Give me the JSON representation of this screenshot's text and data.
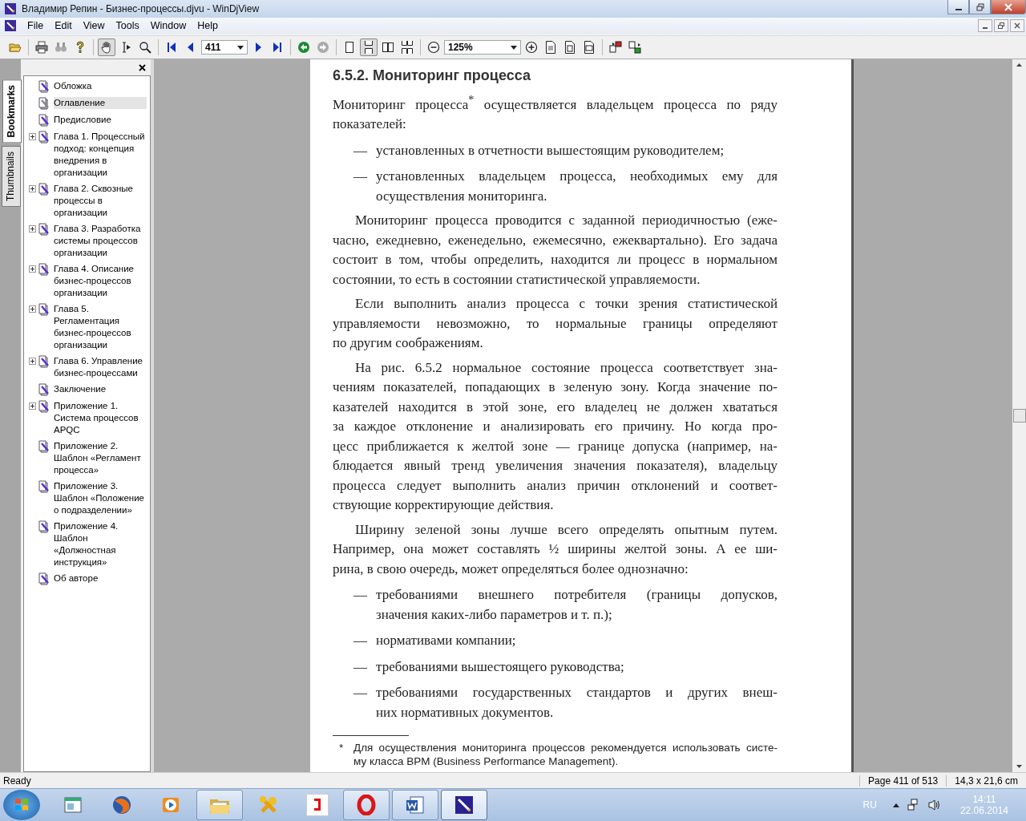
{
  "window": {
    "title": "Владимир Репин - Бизнес-процессы.djvu - WinDjView"
  },
  "menu": [
    "File",
    "Edit",
    "View",
    "Tools",
    "Window",
    "Help"
  ],
  "toolbar": {
    "page_field": "411",
    "zoom_field": "125%",
    "tool_buttons": [
      {
        "selected": true
      },
      {
        "selected": false
      },
      {
        "selected": false
      }
    ],
    "layout_buttons": [
      {
        "selected": false
      },
      {
        "selected": true
      },
      {
        "selected": false
      },
      {
        "selected": false
      }
    ]
  },
  "side_tabs": [
    {
      "label": "Bookmarks",
      "selected": true
    },
    {
      "label": "Thumbnails",
      "selected": false
    }
  ],
  "bookmarks": [
    {
      "label": "Обложка",
      "expandable": false,
      "selected": false
    },
    {
      "label": "Оглавление",
      "expandable": false,
      "selected": true
    },
    {
      "label": "Предисловие",
      "expandable": false,
      "selected": false
    },
    {
      "label": "Глава 1. Процессный подход: концепция внедрения в организации",
      "expandable": true,
      "selected": false
    },
    {
      "label": "Глава 2. Сквозные процессы в организации",
      "expandable": true,
      "selected": false
    },
    {
      "label": "Глава 3. Разработка системы процессов организации",
      "expandable": true,
      "selected": false
    },
    {
      "label": "Глава 4. Описание бизнес-процессов организации",
      "expandable": true,
      "selected": false
    },
    {
      "label": "Глава 5. Регламентация бизнес-процессов организации",
      "expandable": true,
      "selected": false
    },
    {
      "label": "Глава 6. Управление бизнес-процессами",
      "expandable": true,
      "selected": false
    },
    {
      "label": "Заключение",
      "expandable": false,
      "selected": false
    },
    {
      "label": "Приложение 1. Система процессов APQC",
      "expandable": true,
      "selected": false
    },
    {
      "label": "Приложение 2. Шаблон «Регламент процесса»",
      "expandable": false,
      "selected": false
    },
    {
      "label": "Приложение 3. Шаблон «Положение о подразделении»",
      "expandable": false,
      "selected": false
    },
    {
      "label": "Приложение 4. Шаблон «Должностная инструкция»",
      "expandable": false,
      "selected": false
    },
    {
      "label": "Об авторе",
      "expandable": false,
      "selected": false
    }
  ],
  "page": {
    "blocks": [
      {
        "kind": "heading",
        "lines": [
          "6.5.2. Мониторинг процесса"
        ]
      },
      {
        "kind": "paragraph",
        "indent": false,
        "lines": [
          "Мониторинг процесса$^{*}$ осуществляется владельцем процесса по ряду",
          "показателей:"
        ]
      },
      {
        "kind": "dash",
        "marker": "—",
        "lines": [
          "установленных в отчетности вышестоящим руководителем;"
        ]
      },
      {
        "kind": "dash",
        "marker": "—",
        "lines": [
          "установленных владельцем процесса, необходимых ему для",
          "осуществления мониторинга."
        ]
      },
      {
        "kind": "paragraph",
        "indent": true,
        "lines": [
          "Мониторинг процесса проводится с заданной периодичностью (еже-",
          "часно, ежедневно, еженедельно, ежемесячно, ежеквартально). Его задача",
          "состоит в том, чтобы определить, находится ли процесс в нормальном",
          "состоянии, то есть в состоянии статистической управляемости."
        ]
      },
      {
        "kind": "paragraph",
        "indent": true,
        "lines": [
          "Если выполнить анализ процесса с точки зрения статистической",
          "управляемости невозможно, то нормальные границы определяют",
          "по другим соображениям."
        ]
      },
      {
        "kind": "paragraph",
        "indent": true,
        "lines": [
          "На рис. 6.5.2 нормальное состояние процесса соответствует зна-",
          "чениям показателей, попадающих в зеленую зону. Когда значение по-",
          "казателей находится в этой зоне, его владелец не должен хвататься",
          "за каждое отклонение и анализировать его причину. Но когда про-",
          "цесс приближается к желтой зоне — границе допуска (например, на-",
          "блюдается явный тренд увеличения значения показателя), владельцу",
          "процесса следует выполнить анализ причин отклонений и соответ-",
          "ствующие корректирующие действия."
        ]
      },
      {
        "kind": "paragraph",
        "indent": true,
        "lines": [
          "Ширину зеленой зоны лучше всего определять опытным путем.",
          "Например, она может составлять ½ ширины желтой зоны. А ее ши-",
          "рина, в свою очередь, может определяться более однозначно:"
        ]
      },
      {
        "kind": "dash",
        "marker": "—",
        "lines": [
          "требованиями внешнего потребителя (границы допусков,",
          "значения каких-либо параметров и т. п.);"
        ]
      },
      {
        "kind": "dash",
        "marker": "—",
        "lines": [
          "нормативами компании;"
        ]
      },
      {
        "kind": "dash",
        "marker": "—",
        "lines": [
          "требованиями вышестоящего руководства;"
        ]
      },
      {
        "kind": "dash",
        "marker": "—",
        "lines": [
          "требованиями государственных стандартов и других внеш-",
          "них нормативных документов."
        ]
      }
    ],
    "footnote": {
      "mark": "*",
      "lines": [
        "Для осуществления мониторинга процессов рекомендуется использовать систе-",
        "му класса BPM (Business Performance Management)."
      ]
    }
  },
  "status_bar": {
    "message": "Ready",
    "page": "Page 411 of 513",
    "size": "14,3 x 21,6 cm"
  },
  "taskbar": {
    "apps": [
      {
        "kind": "window",
        "running": false,
        "selected": false
      },
      {
        "kind": "browser",
        "running": false,
        "selected": false
      },
      {
        "kind": "player",
        "running": false,
        "selected": false
      },
      {
        "kind": "folder",
        "running": true,
        "selected": false
      },
      {
        "kind": "tool",
        "running": false,
        "selected": false
      },
      {
        "kind": "letter-ya",
        "running": false,
        "selected": false
      },
      {
        "kind": "letter-o",
        "running": true,
        "selected": false
      },
      {
        "kind": "document",
        "running": true,
        "selected": false
      },
      {
        "kind": "viewer",
        "running": true,
        "selected": true
      }
    ],
    "language": "RU",
    "time": "14:11",
    "date": "22.06.2014"
  }
}
